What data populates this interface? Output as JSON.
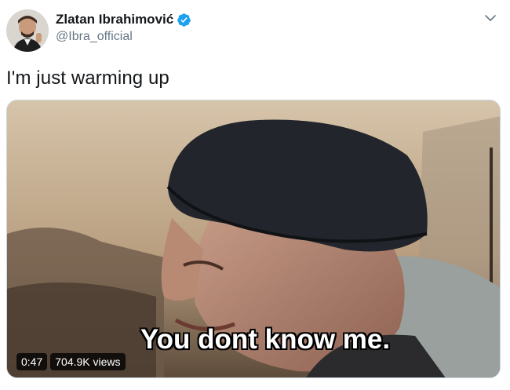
{
  "author": {
    "display_name": "Zlatan Ibrahimović",
    "handle": "@Ibra_official",
    "verified": true
  },
  "tweet": {
    "text": "I'm just warming up"
  },
  "media": {
    "subtitle": "You dont know me.",
    "duration": "0:47",
    "views": "704.9K views"
  },
  "colors": {
    "verified_blue": "#1da1f2",
    "handle_gray": "#657786",
    "caret_gray": "#657786"
  },
  "icons": {
    "verified": "verified-badge-icon",
    "menu": "chevron-down-icon"
  }
}
